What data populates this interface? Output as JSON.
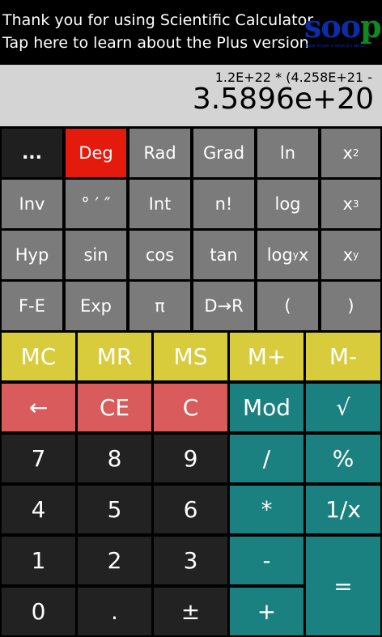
{
  "banner": {
    "line1": "Thank you for using Scientific Calculator",
    "line2": "Tap here to learn about the Plus version"
  },
  "logo": {
    "text_s": "s",
    "text_o1": "o",
    "text_o2": "o",
    "text_p": "p",
    "tagline": "Ease of use is what it's about"
  },
  "display": {
    "expression": "1.2E+22 * (4.258E+21 -",
    "result": "3.5896e+20"
  },
  "sci_rows": [
    [
      "...",
      "Deg",
      "Rad",
      "Grad",
      "ln",
      "x",
      "2"
    ],
    [
      "Inv",
      "° ′ ″",
      "Int",
      "n!",
      "log",
      "x",
      "3"
    ],
    [
      "Hyp",
      "sin",
      "cos",
      "tan",
      "log",
      "y",
      " x",
      "x",
      "y"
    ],
    [
      "F-E",
      "Exp",
      "π",
      "D→R",
      "(",
      ")"
    ]
  ],
  "keys": {
    "more": "...",
    "deg": "Deg",
    "rad": "Rad",
    "grad": "Grad",
    "ln": "ln",
    "x_base": "x",
    "sq_exp": "2",
    "cube_exp": "3",
    "y_exp": "y",
    "inv": "Inv",
    "dms": "° ′ ″",
    "int": "Int",
    "fact": "n!",
    "log": "log",
    "hyp": "Hyp",
    "sin": "sin",
    "cos": "cos",
    "tan": "tan",
    "logy_log": "log",
    "logy_sub": "y",
    "logy_x": " x",
    "fe": "F-E",
    "exp": "Exp",
    "pi": "π",
    "dr": "D→R",
    "lparen": "(",
    "rparen": ")",
    "mc": "MC",
    "mr": "MR",
    "ms": "MS",
    "mplus": "M+",
    "mminus": "M-",
    "back": "←",
    "ce": "CE",
    "c": "C",
    "mod": "Mod",
    "sqrt": "√",
    "n7": "7",
    "n8": "8",
    "n9": "9",
    "div": "/",
    "pct": "%",
    "n4": "4",
    "n5": "5",
    "n6": "6",
    "mul": "*",
    "recip": "1/x",
    "n1": "1",
    "n2": "2",
    "n3": "3",
    "minus": "-",
    "equals": "=",
    "n0": "0",
    "dot": ".",
    "pm": "±",
    "plus": "+"
  },
  "colors": {
    "scientific_key": "#7b7b7b",
    "active_angle_key": "#e41a0c",
    "memory_key": "#d9cc3c",
    "clear_key": "#d95b5b",
    "operator_key": "#1b8080",
    "digit_key": "#222222",
    "display_bg": "#d4d4d4"
  }
}
